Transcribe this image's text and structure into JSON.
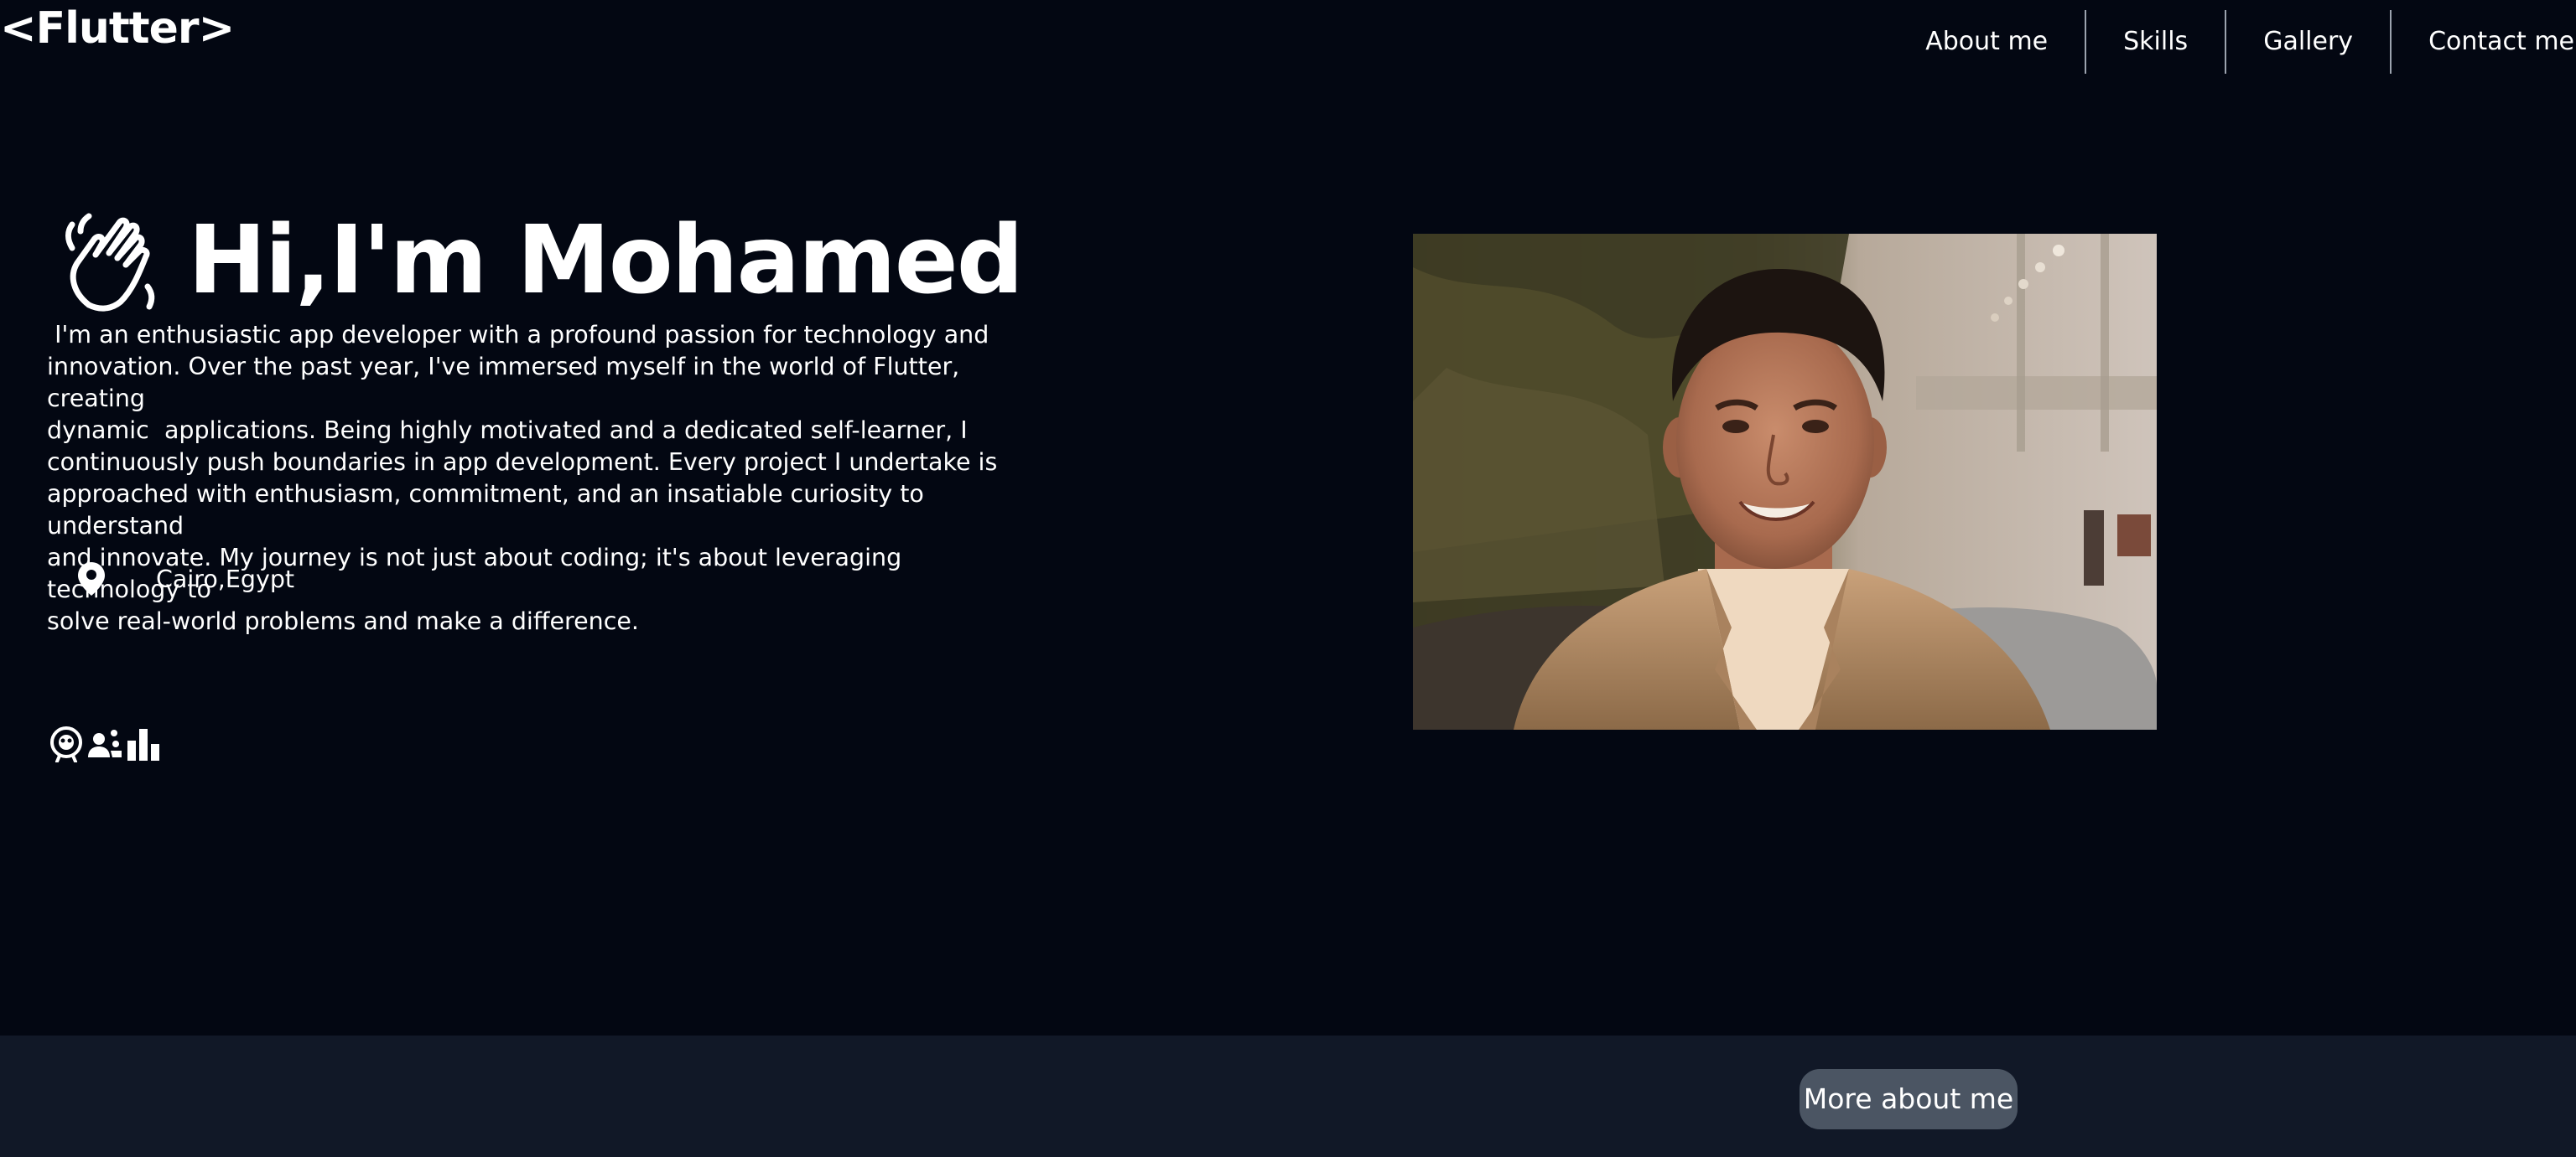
{
  "header": {
    "logo": "<Flutter>",
    "nav": [
      "About me",
      "Skills",
      "Gallery",
      "Contact me"
    ]
  },
  "hero": {
    "greeting": "Hi,I'm Mohamed",
    "bio": " I'm an enthusiastic app developer with a profound passion for technology and\ninnovation. Over the past year, I've immersed myself in the world of Flutter, creating\ndynamic  applications. Being highly motivated and a dedicated self-learner, I\ncontinuously push boundaries in app development. Every project I undertake is\napproached with enthusiasm, commitment, and an insatiable curiosity to understand\nand innovate. My journey is not just about coding; it's about leveraging technology to\nsolve real-world problems and make a difference.",
    "location": "Cairo,Egypt",
    "icons": {
      "greeting": "waving-hand-icon",
      "location": "location-pin-icon",
      "social": [
        "github-icon",
        "community-icon",
        "stats-icon"
      ]
    }
  },
  "about_button": "More about me",
  "colors": {
    "background": "#030712",
    "band": "#111827",
    "button": "#4b5563",
    "text": "#ffffff",
    "divider": "#9ca3af"
  }
}
